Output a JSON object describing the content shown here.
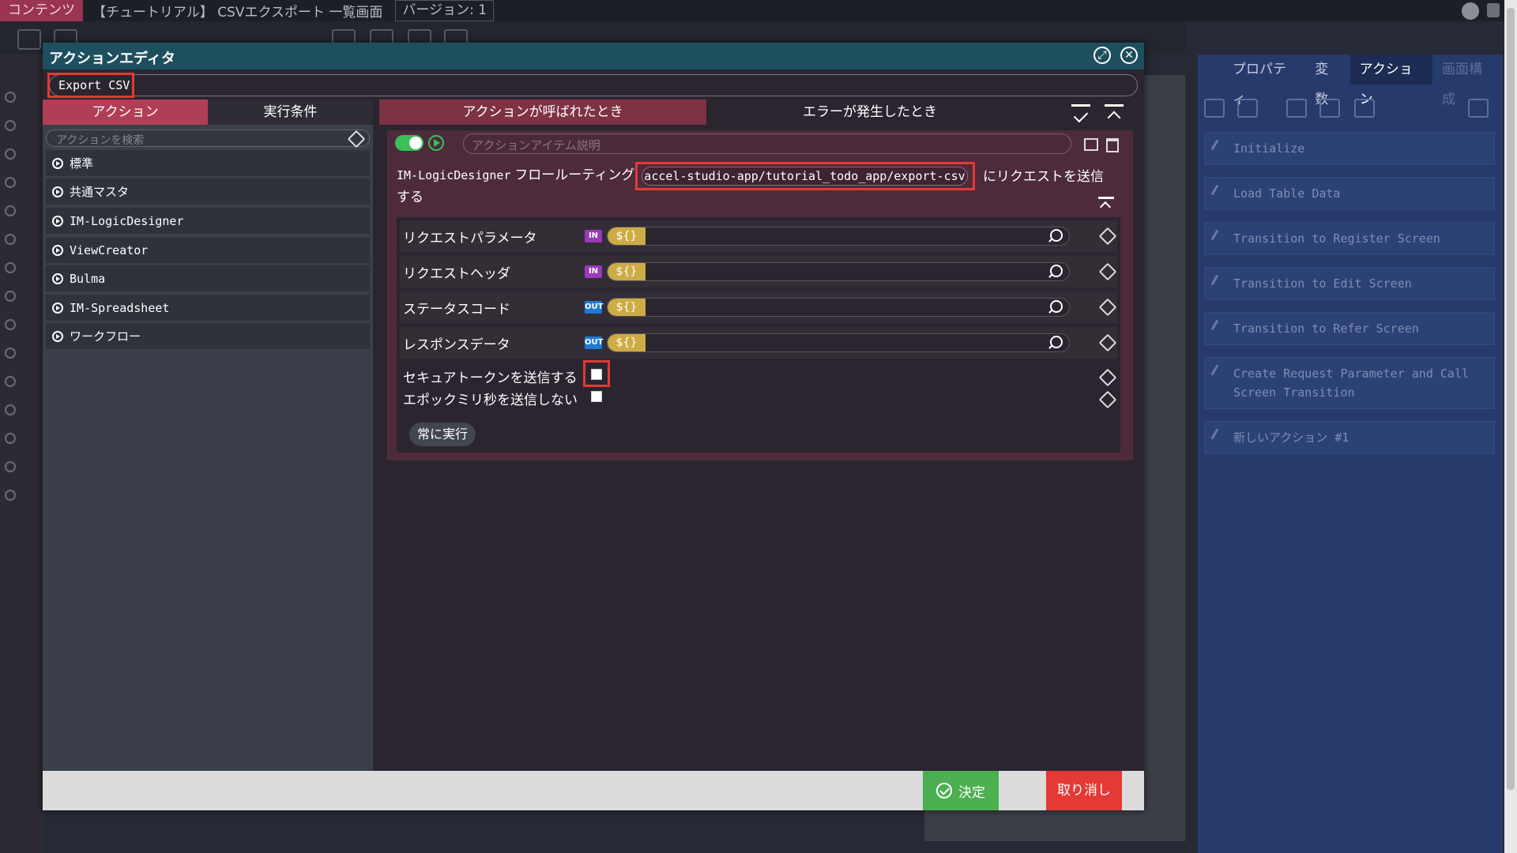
{
  "topbar": {
    "content_tab": "コンテンツ",
    "breadcrumb": "【チュートリアル】 CSVエクスポート 一覧画面",
    "version": "バージョン: 1"
  },
  "right_panel": {
    "tabs": [
      "プロパティ",
      "変数",
      "アクション",
      "画面構成"
    ],
    "active_tab": "アクション",
    "actions": [
      "Initialize",
      "Load Table Data",
      "Transition to Register Screen",
      "Transition to Edit Screen",
      "Transition to Refer Screen",
      "Create Request Parameter and Call Screen Transition",
      "新しいアクション #1"
    ]
  },
  "modal": {
    "title": "アクションエディタ",
    "action_name": "Export CSV",
    "left_tabs": [
      "アクション",
      "実行条件"
    ],
    "search_placeholder": "アクションを検索",
    "categories": [
      "標準",
      "共通マスタ",
      "IM-LogicDesigner",
      "ViewCreator",
      "Bulma",
      "IM-Spreadsheet",
      "ワークフロー"
    ],
    "right_tabs": [
      "アクションが呼ばれたとき",
      "エラーが発生したとき"
    ],
    "item": {
      "description_placeholder": "アクションアイテム説明",
      "flow_prefix": "IM-LogicDesigner",
      "flow_label": "フロールーティング",
      "flow_path": "accel-studio-app/tutorial_todo_app/export-csv",
      "flow_suffix_1": "にリクエストを送信",
      "flow_suffix_2": "する",
      "params": [
        {
          "label": "リクエストパラメータ",
          "direction": "IN",
          "expr": "${}"
        },
        {
          "label": "リクエストヘッダ",
          "direction": "IN",
          "expr": "${}"
        },
        {
          "label": "ステータスコード",
          "direction": "OUT",
          "expr": "${}"
        },
        {
          "label": "レスポンスデータ",
          "direction": "OUT",
          "expr": "${}"
        }
      ],
      "checkboxes": [
        {
          "label": "セキュアトークンを送信する",
          "checked": false
        },
        {
          "label": "エポックミリ秒を送信しない",
          "checked": false
        }
      ],
      "always_run": "常に実行"
    },
    "ok_label": "決定",
    "cancel_label": "取り消し"
  }
}
